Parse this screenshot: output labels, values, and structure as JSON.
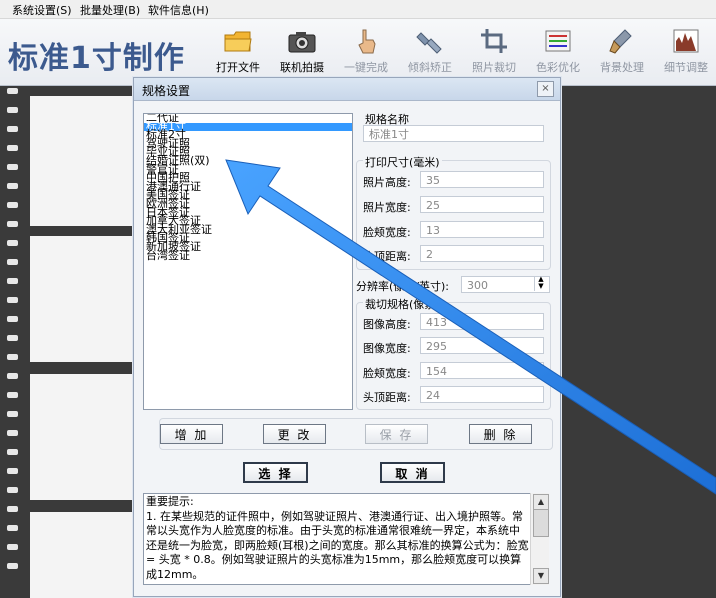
{
  "menu": {
    "items": [
      "系统设置(S)",
      "批量处理(B)",
      "软件信息(H)"
    ]
  },
  "app": {
    "title": "标准1寸制作"
  },
  "toolbar": {
    "open_file": "打开文件",
    "capture": "联机拍摄",
    "one_click": "一键完成",
    "tilt_fix": "倾斜矫正",
    "crop": "照片裁切",
    "color": "色彩优化",
    "background": "背景处理",
    "detail": "细节调整"
  },
  "dialog": {
    "title": "规格设置",
    "close": "×",
    "list": {
      "items": [
        "二代证",
        "标准1寸",
        "标准2寸",
        "驾驶证照",
        "毕业证照",
        "结婚证照(双)",
        "警官证",
        "中国护照",
        "港澳通行证",
        "美国签证",
        "欧洲签证",
        "日本签证",
        "加拿大签证",
        "澳大利亚签证",
        "韩国签证",
        "新加坡签证",
        "台湾签证"
      ],
      "selected_index": 1
    },
    "spec_name": {
      "label": "规格名称",
      "value": "标准1寸"
    },
    "print_size": {
      "label": "打印尺寸(毫米)",
      "fields": [
        {
          "label": "照片高度:",
          "value": "35"
        },
        {
          "label": "照片宽度:",
          "value": "25"
        },
        {
          "label": "脸颊宽度:",
          "value": "13"
        },
        {
          "label": "头顶距离:",
          "value": "2"
        }
      ]
    },
    "resolution": {
      "label": "分辨率(像素/英寸):",
      "value": "300"
    },
    "crop_spec": {
      "label": "裁切规格(像素)",
      "fields": [
        {
          "label": "图像高度:",
          "value": "413"
        },
        {
          "label": "图像宽度:",
          "value": "295"
        },
        {
          "label": "脸颊宽度:",
          "value": "154"
        },
        {
          "label": "头顶距离:",
          "value": "24"
        }
      ]
    },
    "buttons": {
      "add": "增 加",
      "change": "更 改",
      "save": "保 存",
      "delete": "删 除",
      "select": "选 择",
      "cancel": "取 消"
    },
    "notes": {
      "title": "重要提示:",
      "body": "1. 在某些规范的证件照中，例如驾驶证照片、港澳通行证、出入境护照等。常常以头宽作为人脸宽度的标准。由于头宽的标准通常很难统一界定，本系统中还是统一为脸宽，即两脸颊(耳根)之间的宽度。那么其标准的换算公式为：脸宽 = 头宽 * 0.8。例如驾驶证照片的头宽标准为15mm，那么脸颊宽度可以换算成12mm。"
    }
  },
  "colors": {
    "accent_arrow": "#2f86e8",
    "title_blue": "#3c5a8e",
    "selection": "#3399ff"
  }
}
